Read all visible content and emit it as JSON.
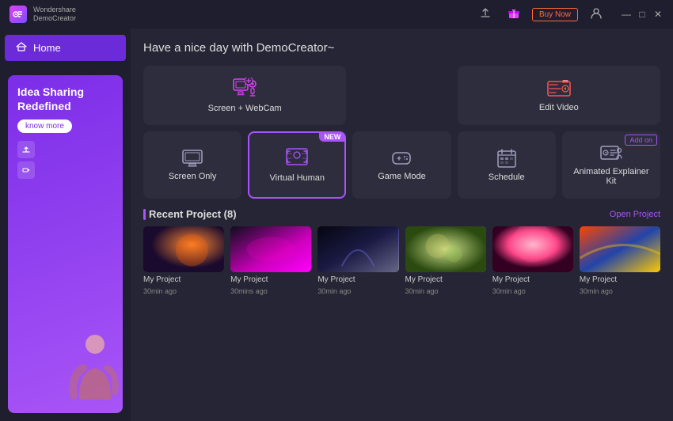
{
  "titleBar": {
    "appName": "Wondershare",
    "appSubtitle": "DemoCreator",
    "buyNow": "Buy Now",
    "minimize": "—",
    "maximize": "□",
    "close": "✕"
  },
  "header": {
    "greeting": "Have a nice day with DemoCreator~"
  },
  "sidebar": {
    "items": [
      {
        "id": "home",
        "label": "Home",
        "icon": "⌂",
        "active": true
      }
    ]
  },
  "promo": {
    "title": "Idea Sharing Redefined",
    "button": "know more"
  },
  "topRow": [
    {
      "id": "screen-webcam",
      "label": "Screen + WebCam",
      "icon": "screen-webcam-icon"
    },
    {
      "id": "edit-video",
      "label": "Edit Video",
      "icon": "edit-video-icon"
    }
  ],
  "bottomRow": [
    {
      "id": "screen-only",
      "label": "Screen Only",
      "icon": "screen-only-icon",
      "featured": false
    },
    {
      "id": "virtual-human",
      "label": "Virtual Human",
      "icon": "virtual-human-icon",
      "featured": true,
      "badge": "NEW"
    },
    {
      "id": "game-mode",
      "label": "Game Mode",
      "icon": "game-mode-icon",
      "featured": false
    },
    {
      "id": "schedule",
      "label": "Schedule",
      "icon": "schedule-icon",
      "featured": false
    },
    {
      "id": "animated-explainer",
      "label": "Animated Explainer Kit",
      "icon": "animated-explainer-icon",
      "featured": false,
      "addOn": "Add on"
    }
  ],
  "recentProjects": {
    "title": "Recent Project (8)",
    "openProject": "Open Project",
    "projects": [
      {
        "label": "My Project",
        "time": "30min ago",
        "thumb": "thumb-1"
      },
      {
        "label": "My Project",
        "time": "30mins ago",
        "thumb": "thumb-2"
      },
      {
        "label": "My Project",
        "time": "30min ago",
        "thumb": "thumb-3"
      },
      {
        "label": "My Project",
        "time": "30min ago",
        "thumb": "thumb-4"
      },
      {
        "label": "My Project",
        "time": "30min ago",
        "thumb": "thumb-5"
      },
      {
        "label": "My Project",
        "time": "30min ago",
        "thumb": "thumb-6"
      }
    ]
  }
}
